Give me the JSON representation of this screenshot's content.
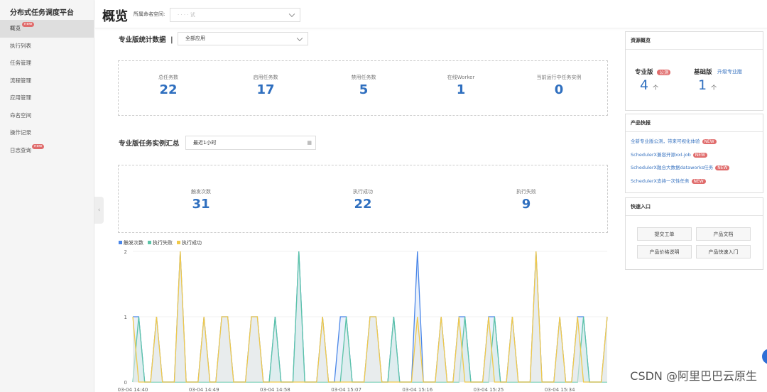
{
  "sidebar": {
    "title": "分布式任务调度平台",
    "items": [
      {
        "label": "概览",
        "badge": "new",
        "active": true
      },
      {
        "label": "执行列表"
      },
      {
        "label": "任务管理"
      },
      {
        "label": "流程管理"
      },
      {
        "label": "应用管理"
      },
      {
        "label": "命名空间"
      },
      {
        "label": "操作记录"
      },
      {
        "label": "日志查询",
        "badge": "new"
      }
    ]
  },
  "header": {
    "title": "概览",
    "namespace_label": "所属命名空间:",
    "namespace_value": "· · · · 试"
  },
  "stats": {
    "title": "专业版统计数据",
    "app_select": "全部应用",
    "items": [
      {
        "label": "总任务数",
        "value": "22"
      },
      {
        "label": "启用任务数",
        "value": "17"
      },
      {
        "label": "禁用任务数",
        "value": "5"
      },
      {
        "label": "在线Worker",
        "value": "1"
      },
      {
        "label": "当前运行中任务实例",
        "value": "0"
      }
    ]
  },
  "instances": {
    "title": "专业版任务实例汇总",
    "range": "最近1小时",
    "items": [
      {
        "label": "触发次数",
        "value": "31"
      },
      {
        "label": "执行成功",
        "value": "22"
      },
      {
        "label": "执行失败",
        "value": "9"
      }
    ]
  },
  "resources": {
    "title": "资源概览",
    "pro_label": "专业版",
    "pro_badge": "公测",
    "pro_count": "4",
    "unit": "个",
    "basic_label": "基础版",
    "upgrade": "升级专业版",
    "basic_count": "1"
  },
  "news": {
    "title": "产品快报",
    "badge": "NEW",
    "items": [
      "全新专业版公测，带来可视化体验",
      "SchedulerX兼容开源xxl-job",
      "SchedulerX融合大数据dataworks任务",
      "SchedulerX支持一次性任务"
    ]
  },
  "quick": {
    "title": "快速入口",
    "buttons": [
      "提交工单",
      "产品文档",
      "产品价格说明",
      "产品快速入门"
    ]
  },
  "watermark": "CSDN @阿里巴巴云原生",
  "chart_data": {
    "type": "area",
    "ylim": [
      0,
      2
    ],
    "y_ticks": [
      "0",
      "1",
      "2"
    ],
    "x_ticks": [
      {
        "label": "03-04 14:40",
        "index": 0
      },
      {
        "label": "03-04 14:49",
        "index": 12
      },
      {
        "label": "03-04 14:58",
        "index": 24
      },
      {
        "label": "03-04 15:07",
        "index": 36
      },
      {
        "label": "03-04 15:16",
        "index": 48
      },
      {
        "label": "03-04 15:25",
        "index": 60
      },
      {
        "label": "03-04 15:34",
        "index": 72
      }
    ],
    "legend": "top-left",
    "series": [
      {
        "name": "触发次数",
        "color": "#4a86e8",
        "fill": "#dce8f8",
        "values": [
          1,
          1,
          0,
          0,
          1,
          0,
          0,
          0,
          2,
          0,
          0,
          0,
          1,
          0,
          0,
          1,
          1,
          0,
          0,
          0,
          1,
          1,
          0,
          0,
          1,
          0,
          0,
          0,
          2,
          0,
          0,
          0,
          1,
          0,
          0,
          1,
          1,
          0,
          0,
          0,
          1,
          1,
          0,
          0,
          1,
          0,
          0,
          0,
          2,
          0,
          0,
          0,
          1,
          0,
          0,
          1,
          1,
          0,
          0,
          0,
          1,
          1,
          0,
          0,
          1,
          0,
          0,
          0,
          2,
          0,
          0,
          0,
          1,
          0,
          0,
          1,
          1,
          0,
          0,
          0,
          1
        ]
      },
      {
        "name": "执行失败",
        "color": "#5cc4a8",
        "fill": "#d5ebe8",
        "values": [
          0,
          1,
          0,
          0,
          0,
          0,
          0,
          0,
          0,
          0,
          0,
          0,
          0,
          0,
          0,
          0,
          0,
          0,
          0,
          0,
          0,
          0,
          0,
          0,
          1,
          0,
          0,
          0,
          2,
          0,
          0,
          0,
          0,
          0,
          0,
          0,
          1,
          0,
          0,
          0,
          0,
          0,
          0,
          0,
          1,
          0,
          0,
          0,
          0,
          0,
          0,
          0,
          0,
          0,
          0,
          0,
          1,
          0,
          0,
          0,
          0,
          1,
          0,
          0,
          0,
          0,
          0,
          0,
          0,
          0,
          0,
          0,
          0,
          0,
          0,
          0,
          1,
          0,
          0,
          0,
          0
        ]
      },
      {
        "name": "执行成功",
        "color": "#f0c94a",
        "fill": "#e6e9e4",
        "values": [
          1,
          0,
          0,
          0,
          1,
          0,
          0,
          0,
          2,
          0,
          0,
          0,
          1,
          0,
          0,
          1,
          1,
          0,
          0,
          0,
          1,
          1,
          0,
          0,
          0,
          0,
          0,
          0,
          0,
          0,
          0,
          0,
          1,
          0,
          0,
          0,
          0,
          0,
          0,
          0,
          1,
          1,
          0,
          0,
          0,
          0,
          0,
          0,
          1,
          0,
          0,
          0,
          1,
          0,
          0,
          1,
          0,
          0,
          0,
          0,
          1,
          0,
          0,
          0,
          1,
          0,
          0,
          0,
          2,
          0,
          0,
          0,
          1,
          0,
          0,
          1,
          0,
          0,
          0,
          0,
          1
        ]
      }
    ]
  }
}
